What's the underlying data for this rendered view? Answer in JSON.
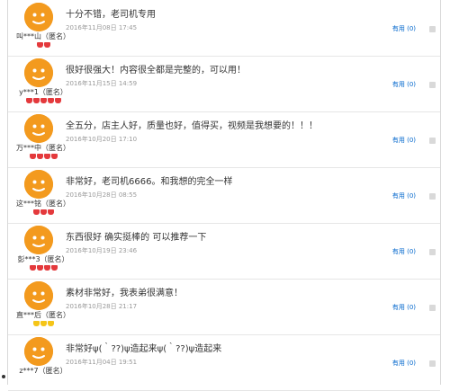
{
  "reviews": [
    {
      "user": "叫***山（匿名）",
      "content": "十分不错，老司机专用",
      "date": "2016年11月08日 17:45",
      "useful": "有用 (0)",
      "gems": [
        "red",
        "red"
      ]
    },
    {
      "user": "y***1（匿名）",
      "content": "很好很强大！内容很全都是完整的，可以用！",
      "date": "2016年11月15日 14:59",
      "useful": "有用 (0)",
      "gems": [
        "red",
        "red",
        "red",
        "red",
        "red"
      ]
    },
    {
      "user": "万***中（匿名）",
      "content": "全五分，店主人好，质量也好，值得买，视频是我想要的！！！",
      "date": "2016年10月20日 17:10",
      "useful": "有用 (0)",
      "gems": [
        "red",
        "red",
        "red",
        "red"
      ]
    },
    {
      "user": "这***铭（匿名）",
      "content": "非常好，老司机6666。和我想的完全一样",
      "date": "2016年10月28日 08:55",
      "useful": "有用 (0)",
      "gems": [
        "red",
        "red",
        "red"
      ]
    },
    {
      "user": "彭***3（匿名）",
      "content": "东西很好 确实挺棒的 可以推荐一下",
      "date": "2016年10月19日 23:46",
      "useful": "有用 (0)",
      "gems": [
        "red",
        "red",
        "red",
        "red"
      ]
    },
    {
      "user": "直***后（匿名）",
      "content": "素材非常好，我表弟很满意！",
      "date": "2016年10月28日 21:17",
      "useful": "有用 (0)",
      "gems": [
        "yellow",
        "yellow",
        "yellow"
      ]
    },
    {
      "user": "z***7（匿名）",
      "content": "非常好ψ(｀??)ψ造起来ψ(｀??)ψ造起来",
      "date": "2016年11月04日 19:51",
      "useful": "有用 (0)",
      "gems": []
    }
  ]
}
